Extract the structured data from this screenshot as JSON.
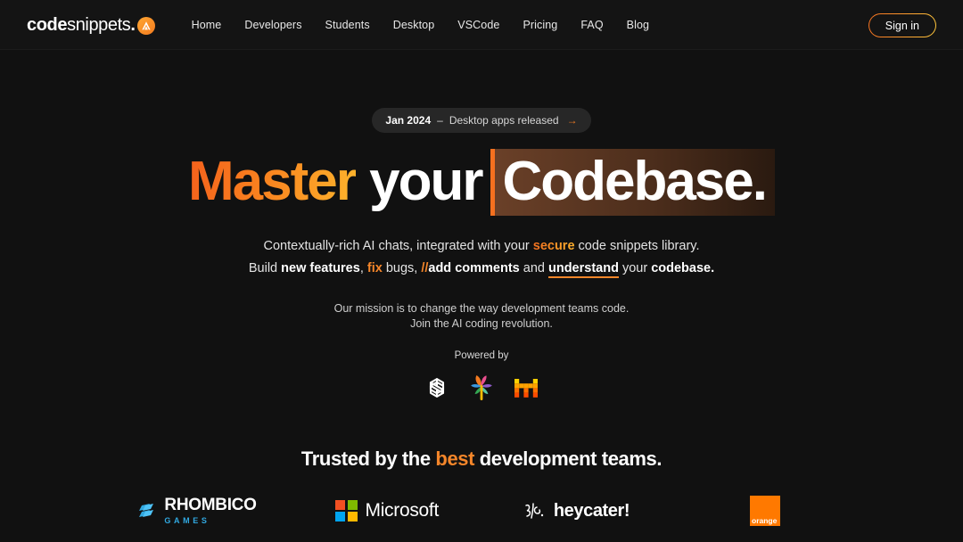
{
  "header": {
    "brand": {
      "bold": "code",
      "light": "snippets",
      "dot": ".",
      "mark_icon": "codesnippets-logo-icon"
    },
    "nav": [
      {
        "label": "Home"
      },
      {
        "label": "Developers"
      },
      {
        "label": "Students"
      },
      {
        "label": "Desktop"
      },
      {
        "label": "VSCode"
      },
      {
        "label": "Pricing"
      },
      {
        "label": "FAQ"
      },
      {
        "label": "Blog"
      }
    ],
    "signin_label": "Sign in"
  },
  "hero": {
    "announcement": {
      "date": "Jan 2024",
      "dash": "–",
      "text": "Desktop apps released",
      "arrow": "→"
    },
    "headline": {
      "word1": "Master",
      "word2": "your",
      "word3": "Codebase."
    },
    "subtitle_line1": {
      "part1": "Contextually-rich AI chats, integrated with your ",
      "highlight": "secure",
      "part2": " code snippets library."
    },
    "subtitle_line2": {
      "p1": "Build ",
      "b1": "new features",
      "p2": ", ",
      "o1": "fix",
      "p3": " bugs, ",
      "slashes": "//",
      "b2": "add comments",
      "p4": " and ",
      "u1": "understand",
      "p5": " your ",
      "b3": "codebase."
    },
    "mission_line1": "Our mission is to change the way development teams code.",
    "mission_line2": "Join the AI coding revolution.",
    "powered_by_label": "Powered by",
    "powered_logos": [
      {
        "name": "openai-logo-icon"
      },
      {
        "name": "google-palm-logo-icon"
      },
      {
        "name": "mistral-ai-logo-icon"
      }
    ]
  },
  "trusted": {
    "title_part1": "Trusted by the ",
    "title_highlight": "best",
    "title_part2": " development teams.",
    "logos": [
      {
        "name": "rhombico-games-logo",
        "main": "RHOMBICO",
        "sub": "GAMES"
      },
      {
        "name": "microsoft-logo",
        "text": "Microsoft"
      },
      {
        "name": "heycater-logo",
        "text": "heycater!"
      },
      {
        "name": "orange-logo",
        "text": "orange"
      }
    ]
  },
  "colors": {
    "background": "#111111",
    "header_background": "#141414",
    "accent_orange": "#f5862a",
    "accent_gradient_start": "#f4601c",
    "accent_gradient_end": "#fcb52c",
    "selection_highlight": "#6a4028",
    "rhombico_blue": "#31a8e0",
    "orange_brand": "#ff7900"
  }
}
